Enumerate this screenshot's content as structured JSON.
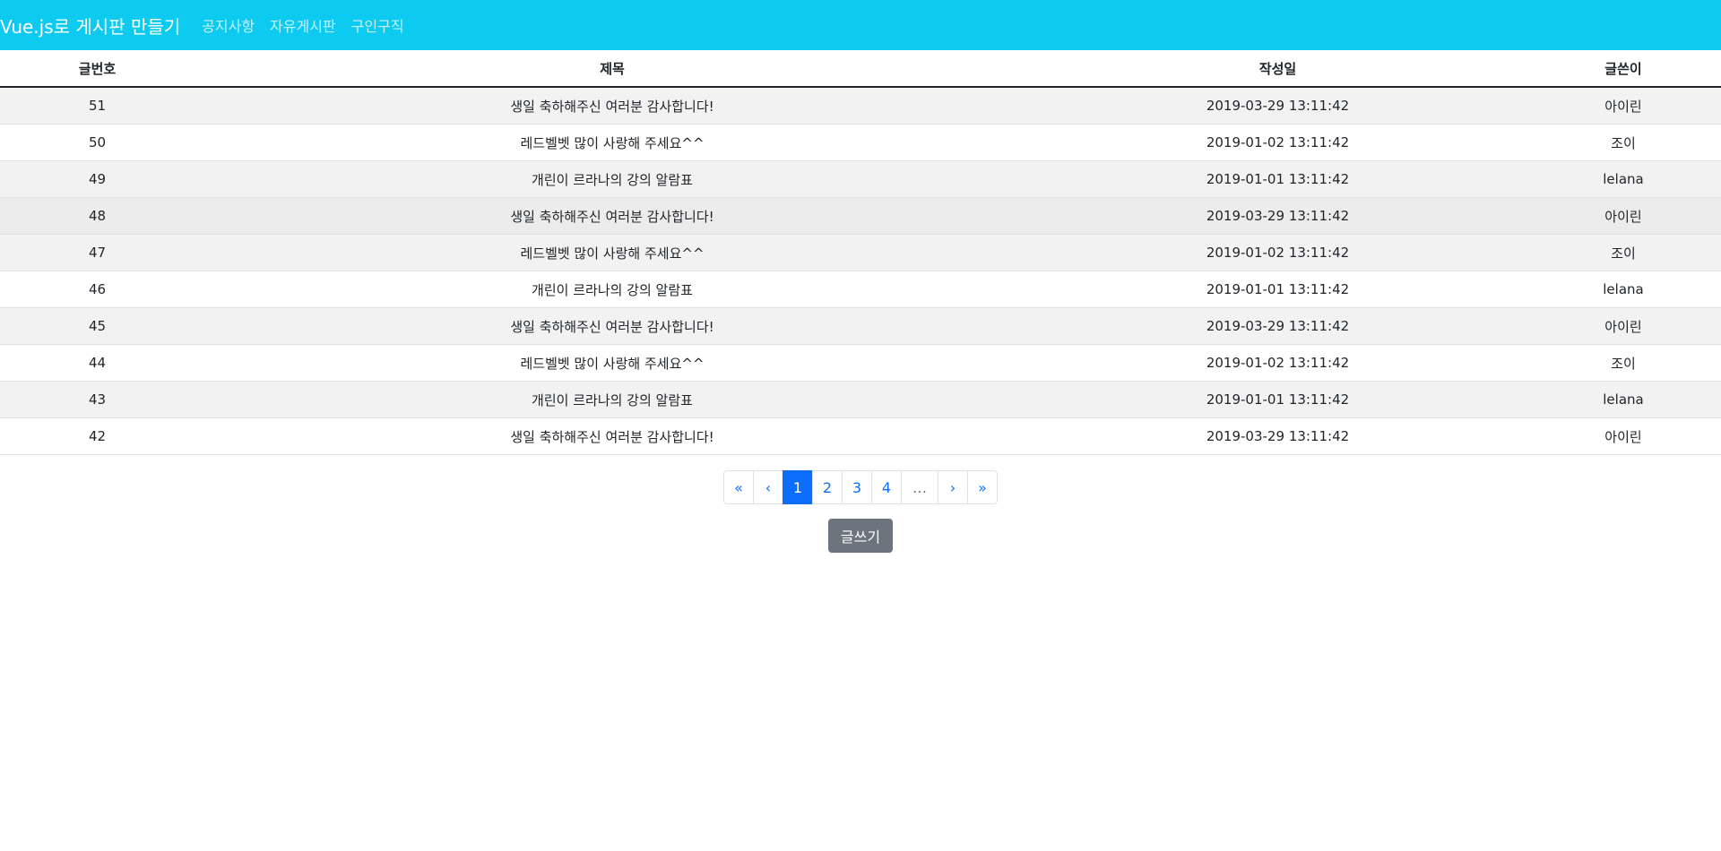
{
  "navbar": {
    "brand": "Vue.js로 게시판 만들기",
    "links": [
      "공지사항",
      "자유게시판",
      "구인구직"
    ]
  },
  "table": {
    "headers": [
      "글번호",
      "제목",
      "작성일",
      "글쓴이"
    ],
    "rows": [
      [
        "51",
        "생일 축하해주신 여러분 감사합니다!",
        "2019-03-29 13:11:42",
        "아이린"
      ],
      [
        "50",
        "레드벨벳 많이 사랑해 주세요^^",
        "2019-01-02 13:11:42",
        "조이"
      ],
      [
        "49",
        "개린이 르라나의 강의 알람표",
        "2019-01-01 13:11:42",
        "lelana"
      ],
      [
        "48",
        "생일 축하해주신 여러분 감사합니다!",
        "2019-03-29 13:11:42",
        "아이린"
      ],
      [
        "47",
        "레드벨벳 많이 사랑해 주세요^^",
        "2019-01-02 13:11:42",
        "조이"
      ],
      [
        "46",
        "개린이 르라나의 강의 알람표",
        "2019-01-01 13:11:42",
        "lelana"
      ],
      [
        "45",
        "생일 축하해주신 여러분 감사합니다!",
        "2019-03-29 13:11:42",
        "아이린"
      ],
      [
        "44",
        "레드벨벳 많이 사랑해 주세요^^",
        "2019-01-02 13:11:42",
        "조이"
      ],
      [
        "43",
        "개린이 르라나의 강의 알람표",
        "2019-01-01 13:11:42",
        "lelana"
      ],
      [
        "42",
        "생일 축하해주신 여러분 감사합니다!",
        "2019-03-29 13:11:42",
        "아이린"
      ]
    ]
  },
  "pagination": {
    "first": "«",
    "prev": "‹",
    "pages": [
      "1",
      "2",
      "3",
      "4"
    ],
    "active_page": "1",
    "ellipsis": "…",
    "next": "›",
    "last": "»"
  },
  "write_button": "글쓰기",
  "colors": {
    "navbar": "#0dcaf0",
    "active_page": "#0d6efd",
    "write_button": "#6c757d"
  }
}
